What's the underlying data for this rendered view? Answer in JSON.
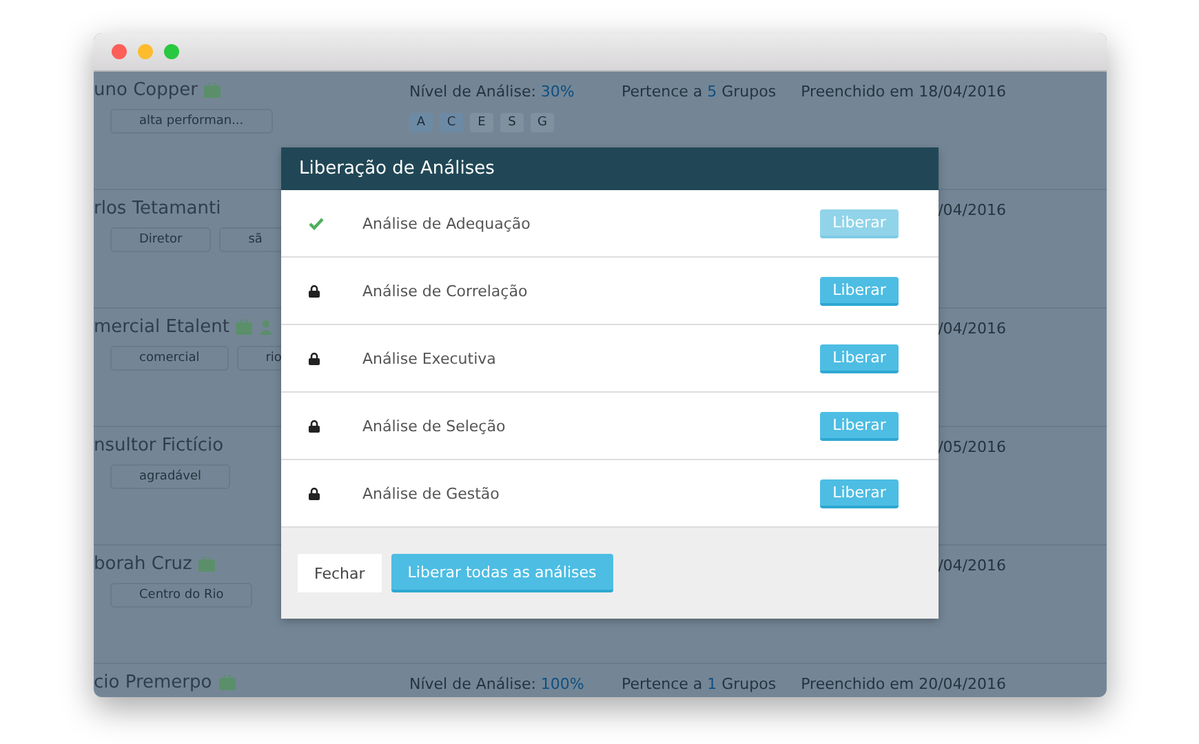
{
  "rows": [
    {
      "name": "uno Copper",
      "icons": [
        {
          "kind": "briefcase"
        }
      ],
      "tags": [
        "alta performan..."
      ],
      "analysis_label": "Nível de Análise:",
      "analysis_value": "30%",
      "letters": [
        {
          "label": "A",
          "selected": true
        },
        {
          "label": "C",
          "selected": true
        },
        {
          "label": "E",
          "selected": false
        },
        {
          "label": "S",
          "selected": false
        },
        {
          "label": "G",
          "selected": false
        }
      ],
      "groups_label": "Pertence a",
      "groups_count": "5",
      "groups_suffix": "Grupos",
      "date": "Preenchido em 18/04/2016"
    },
    {
      "name": "rlos Tetamanti",
      "icons": [],
      "tags": [
        "Diretor",
        "sã"
      ],
      "date": "/04/2016"
    },
    {
      "name": "mercial Etalent",
      "icons": [
        {
          "kind": "briefcase"
        },
        {
          "kind": "person"
        }
      ],
      "tags": [
        "comercial",
        "rio"
      ],
      "date": "/04/2016"
    },
    {
      "name": "nsultor Fictício",
      "icons": [],
      "tags": [
        "agradável"
      ],
      "date": "/05/2016"
    },
    {
      "name": "borah Cruz",
      "icons": [
        {
          "kind": "briefcase"
        }
      ],
      "tags": [
        "Centro do Rio"
      ],
      "date": "/04/2016"
    },
    {
      "name": "cio Premerpo",
      "icons": [
        {
          "kind": "briefcase"
        }
      ],
      "tags": [],
      "analysis_label": "Nível de Análise:",
      "analysis_value": "100%",
      "groups_label": "Pertence a",
      "groups_count": "1",
      "groups_suffix": "Grupos",
      "date": "Preenchido em 20/04/2016"
    }
  ],
  "modal": {
    "title": "Liberação de Análises",
    "items": [
      {
        "label": "Análise de Adequação",
        "released": true,
        "button": "Liberar"
      },
      {
        "label": "Análise de Correlação",
        "released": false,
        "button": "Liberar"
      },
      {
        "label": "Análise Executiva",
        "released": false,
        "button": "Liberar"
      },
      {
        "label": "Análise de Seleção",
        "released": false,
        "button": "Liberar"
      },
      {
        "label": "Análise de Gestão",
        "released": false,
        "button": "Liberar"
      }
    ],
    "close_button": "Fechar",
    "release_all_button": "Liberar todas as análises"
  }
}
